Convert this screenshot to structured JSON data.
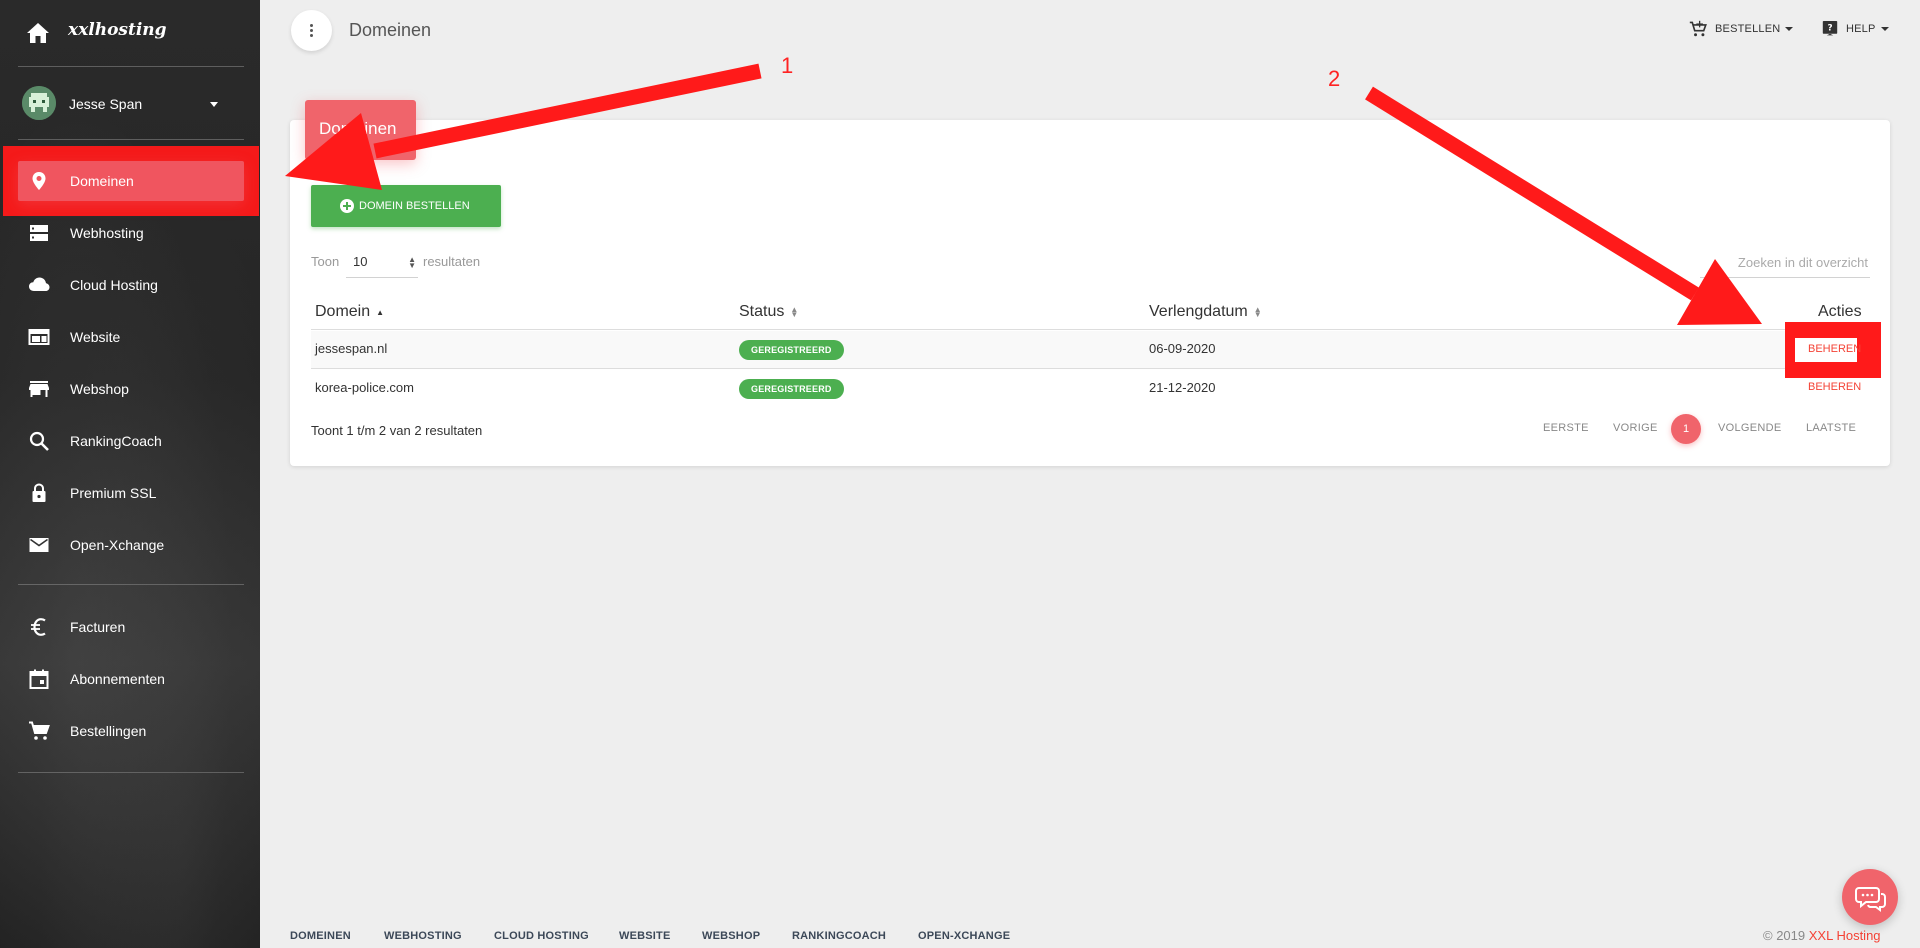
{
  "brand": {
    "name": "xxlhosting"
  },
  "user": {
    "name": "Jesse Span"
  },
  "sidebar": {
    "items": [
      {
        "label": "Domeinen",
        "icon": "location-pin-icon"
      },
      {
        "label": "Webhosting",
        "icon": "server-icon"
      },
      {
        "label": "Cloud Hosting",
        "icon": "cloud-icon"
      },
      {
        "label": "Website",
        "icon": "web-window-icon"
      },
      {
        "label": "Webshop",
        "icon": "store-icon"
      },
      {
        "label": "RankingCoach",
        "icon": "search-icon"
      },
      {
        "label": "Premium SSL",
        "icon": "lock-icon"
      },
      {
        "label": "Open-Xchange",
        "icon": "mail-icon"
      }
    ],
    "secondary": [
      {
        "label": "Facturen",
        "icon": "euro-icon"
      },
      {
        "label": "Abonnementen",
        "icon": "calendar-icon"
      },
      {
        "label": "Bestellingen",
        "icon": "cart-icon"
      }
    ]
  },
  "header": {
    "title": "Domeinen",
    "order_label": "BESTELLEN",
    "help_label": "HELP"
  },
  "card": {
    "tab_title": "Domeinen",
    "order_button": "DOMEIN BESTELLEN",
    "show_label": "Toon",
    "page_size": "10",
    "results_label": "resultaten",
    "search_placeholder": "Zoeken in dit overzicht",
    "columns": [
      "Domein",
      "Status",
      "Verlengdatum",
      "Acties"
    ],
    "rows": [
      {
        "domain": "jessespan.nl",
        "status": "GEREGISTREERD",
        "renewal": "06-09-2020",
        "action": "BEHEREN"
      },
      {
        "domain": "korea-police.com",
        "status": "GEREGISTREERD",
        "renewal": "21-12-2020",
        "action": "BEHEREN"
      }
    ],
    "summary": "Toont 1 t/m 2 van 2 resultaten",
    "pagination": {
      "first": "EERSTE",
      "prev": "VORIGE",
      "current": "1",
      "next": "VOLGENDE",
      "last": "LAATSTE"
    }
  },
  "footer": {
    "links": [
      "DOMEINEN",
      "WEBHOSTING",
      "CLOUD HOSTING",
      "WEBSITE",
      "WEBSHOP",
      "RANKINGCOACH",
      "OPEN-XCHANGE"
    ],
    "copyright": "© 2019",
    "copyright_brand": "XXL Hosting"
  },
  "annotations": {
    "first": "1",
    "second": "2"
  },
  "colors": {
    "accent": "#f0646b",
    "success": "#4caf50",
    "annotation": "#ff1a1a",
    "sidebar": "#2a2a2a"
  }
}
